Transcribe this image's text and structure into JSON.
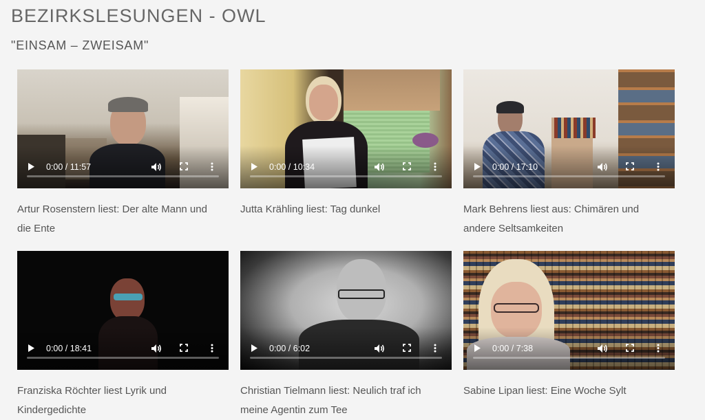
{
  "page": {
    "title": "BEZIRKSLESUNGEN - OWL",
    "subtitle": "\"EINSAM – ZWEISAM\""
  },
  "videos": [
    {
      "time": "0:00 / 11:57",
      "caption": "Artur Rosenstern liest: Der alte Mann und die Ente"
    },
    {
      "time": "0:00 / 10:34",
      "caption": "Jutta Krähling liest: Tag dunkel"
    },
    {
      "time": "0:00 / 17:10",
      "caption": "Mark Behrens liest aus: Chimären und andere Seltsamkeiten"
    },
    {
      "time": "0:00 / 18:41",
      "caption": "Franziska Röchter liest Lyrik und Kindergedichte"
    },
    {
      "time": "0:00 / 6:02",
      "caption": "Christian Tielmann liest: Neulich traf ich meine Agentin zum Tee"
    },
    {
      "time": "0:00 / 7:38",
      "caption": "Sabine Lipan liest: Eine Woche Sylt"
    }
  ],
  "icons": {
    "play": "play-icon",
    "volume": "volume-icon",
    "fullscreen": "fullscreen-icon",
    "more": "more-vert-icon"
  },
  "colors": {
    "background": "#f4f4f4",
    "text": "#555555",
    "controls": "#ffffff"
  }
}
